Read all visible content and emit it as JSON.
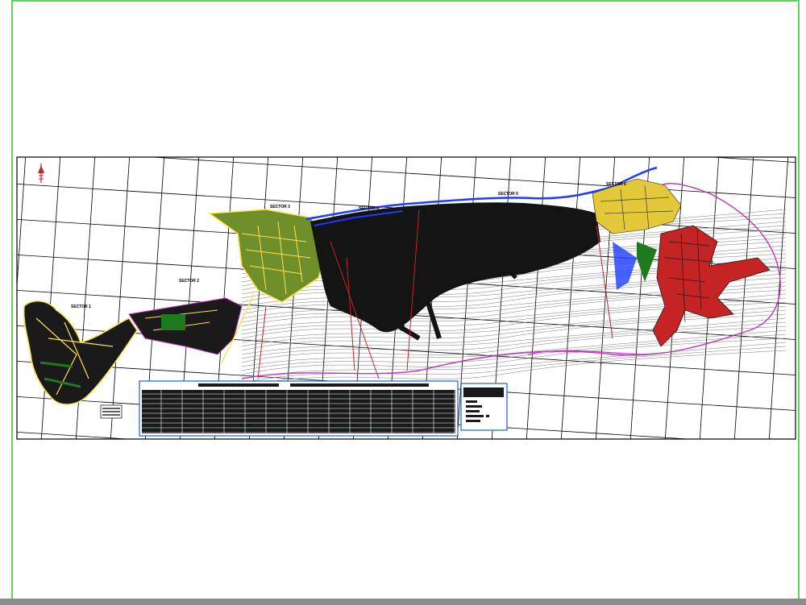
{
  "drawing": {
    "sector_labels": [
      "SECTOR 1",
      "SECTOR 2",
      "SECTOR 3",
      "SECTOR 4",
      "SECTOR 5",
      "SECTOR 6"
    ],
    "north_arrow": "north-arrow-icon",
    "colors": {
      "frame": "#5fd35f",
      "map_border": "#000000",
      "water": "#1d3cff",
      "parks": "#1f7a1f",
      "blocks_yellow": "#ffe14a",
      "blocks_red": "#d11f1f",
      "contours": "#777777",
      "boundary": "#c233c2",
      "table_header": "#1f5fd3"
    }
  }
}
